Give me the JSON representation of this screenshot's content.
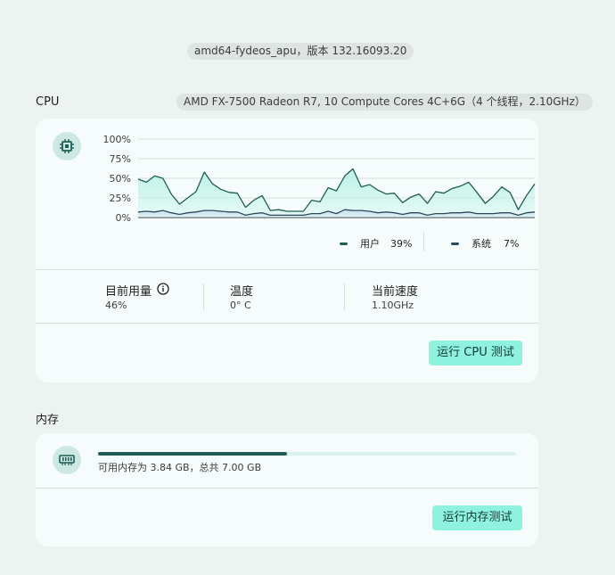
{
  "header": {
    "version": "amd64-fydeos_apu，版本 132.16093.20"
  },
  "cpu": {
    "section_label": "CPU",
    "model": "AMD FX-7500 Radeon R7, 10 Compute Cores 4C+6G（4 个线程，2.10GHz）",
    "icon": "cpu-chip-icon",
    "legend": {
      "user_label": "用户",
      "user_value": "39%",
      "system_label": "系统",
      "system_value": "7%"
    },
    "stats": {
      "usage_label": "目前用量",
      "usage_value": "46%",
      "temp_label": "温度",
      "temp_value": "0° C",
      "speed_label": "当前速度",
      "speed_value": "1.10GHz"
    },
    "test_button": "运行 CPU 测试",
    "colors": {
      "user": "#1d5f55",
      "user_fill": "#b9f2e6",
      "system": "#2a4a5c",
      "system_fill": "#c9ddf0"
    }
  },
  "chart_data": {
    "type": "area",
    "y_ticks": [
      "100%",
      "75%",
      "50%",
      "25%",
      "0%"
    ],
    "ylim": [
      0,
      100
    ],
    "series": [
      {
        "name": "用户",
        "values": [
          49,
          45,
          53,
          50,
          30,
          17,
          25,
          33,
          58,
          43,
          36,
          32,
          31,
          13,
          22,
          28,
          9,
          10,
          8,
          8,
          8,
          22,
          20,
          38,
          34,
          53,
          62,
          39,
          42,
          35,
          30,
          31,
          19,
          26,
          30,
          18,
          33,
          31,
          37,
          40,
          45,
          32,
          18,
          27,
          39,
          32,
          10,
          28,
          43
        ]
      },
      {
        "name": "系统",
        "values": [
          7,
          8,
          7,
          9,
          6,
          4,
          6,
          7,
          9,
          9,
          8,
          7,
          7,
          3,
          5,
          6,
          3,
          3,
          3,
          3,
          3,
          5,
          5,
          8,
          5,
          10,
          9,
          9,
          8,
          6,
          7,
          6,
          4,
          6,
          6,
          3,
          5,
          5,
          6,
          6,
          7,
          5,
          5,
          5,
          6,
          6,
          3,
          6,
          7
        ]
      }
    ]
  },
  "memory": {
    "section_label": "内存",
    "icon": "memory-chip-icon",
    "used_fraction": 0.452,
    "description": "可用内存为 3.84 GB，总共 7.00 GB",
    "test_button": "运行内存测试"
  }
}
